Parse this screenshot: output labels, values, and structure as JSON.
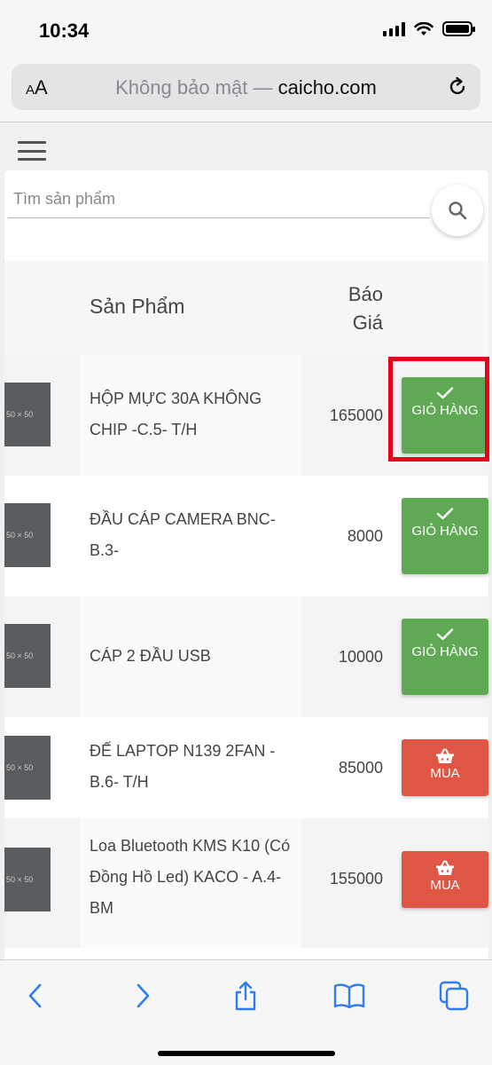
{
  "status_bar": {
    "time": "10:34"
  },
  "browser": {
    "aa_label_small": "A",
    "aa_label_big": "A",
    "security_text": "Không bảo mật — ",
    "domain": "caicho.com"
  },
  "search": {
    "placeholder": "Tìm sản phẩm",
    "value": ""
  },
  "table": {
    "headers": {
      "product": "Sản Phẩm",
      "price_line1": "Báo",
      "price_line2": "Giá"
    },
    "thumb_label": "50 × 50",
    "rows": [
      {
        "name": "HỘP MỰC 30A KHÔNG CHIP -C.5- T/H",
        "price": "165000",
        "action": "GIỎ HÀNG",
        "status": "in_cart"
      },
      {
        "name": "ĐẦU CÁP CAMERA BNC- B.3-",
        "price": "8000",
        "action": "GIỎ HÀNG",
        "status": "in_cart"
      },
      {
        "name": "CÁP 2 ĐẦU USB",
        "price": "10000",
        "action": "GIỎ HÀNG",
        "status": "in_cart"
      },
      {
        "name": "ĐẾ LAPTOP N139 2FAN - B.6- T/H",
        "price": "85000",
        "action": "MUA",
        "status": "buy"
      },
      {
        "name": "Loa Bluetooth KMS K10 (Có Đồng Hồ Led) KACO - A.4-BM",
        "price": "155000",
        "action": "MUA",
        "status": "buy"
      }
    ]
  },
  "colors": {
    "cart_green": "#5fa854",
    "buy_red": "#e05644",
    "highlight": "#e8001c",
    "ios_blue": "#2f7cf6"
  },
  "icons": {
    "check": "check-icon",
    "basket": "basket-icon",
    "search": "search-icon",
    "menu": "menu-icon",
    "toolbar": [
      "back-icon",
      "forward-icon",
      "share-icon",
      "bookmarks-icon",
      "tabs-icon"
    ]
  }
}
